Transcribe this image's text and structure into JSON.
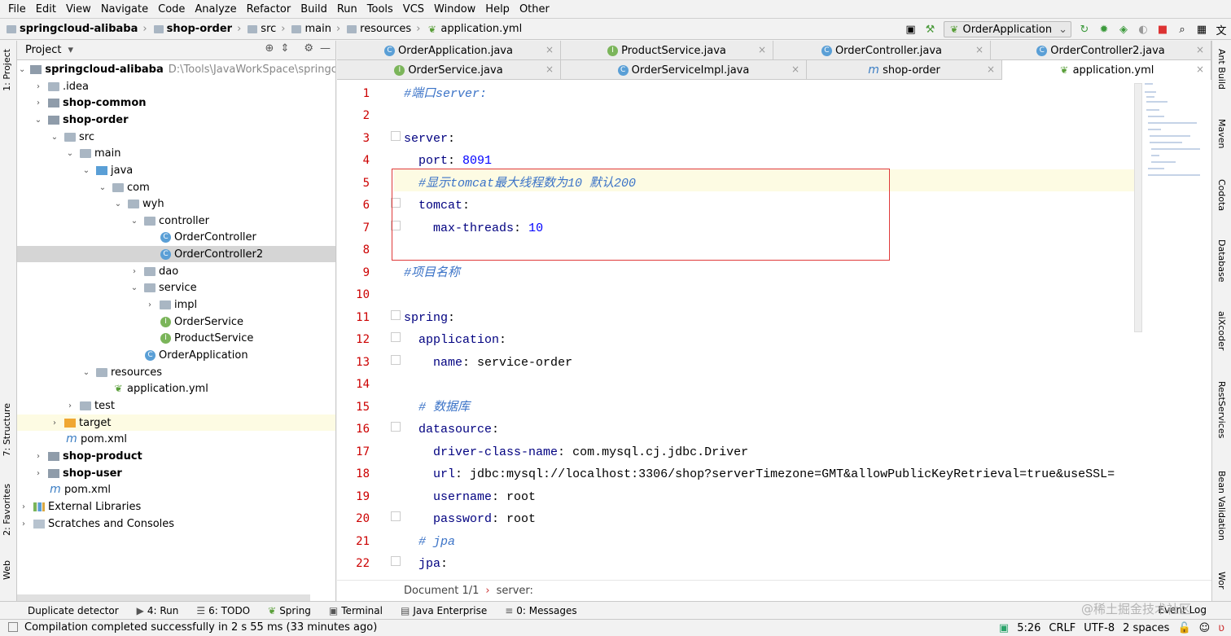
{
  "menu": [
    "File",
    "Edit",
    "View",
    "Navigate",
    "Code",
    "Analyze",
    "Refactor",
    "Build",
    "Run",
    "Tools",
    "VCS",
    "Window",
    "Help",
    "Other"
  ],
  "breadcrumbs": [
    "springcloud-alibaba",
    "shop-order",
    "src",
    "main",
    "resources",
    "application.yml"
  ],
  "run_config": "OrderApplication",
  "left_tabs": {
    "project": "1: Project",
    "structure": "7: Structure",
    "favorites": "2: Favorites",
    "web": "Web"
  },
  "right_tabs": [
    "Ant Build",
    "Maven",
    "Codota",
    "Database",
    "aiXcoder",
    "RestServices",
    "Bean Validation",
    "Wor"
  ],
  "project_panel": {
    "title": "Project"
  },
  "tree": [
    {
      "label": "springcloud-alibaba",
      "hint": "D:\\Tools\\JavaWorkSpace\\springcloud-a"
    },
    {
      "label": ".idea"
    },
    {
      "label": "shop-common"
    },
    {
      "label": "shop-order"
    },
    {
      "label": "src"
    },
    {
      "label": "main"
    },
    {
      "label": "java"
    },
    {
      "label": "com"
    },
    {
      "label": "wyh"
    },
    {
      "label": "controller"
    },
    {
      "label": "OrderController"
    },
    {
      "label": "OrderController2"
    },
    {
      "label": "dao"
    },
    {
      "label": "service"
    },
    {
      "label": "impl"
    },
    {
      "label": "OrderService"
    },
    {
      "label": "ProductService"
    },
    {
      "label": "OrderApplication"
    },
    {
      "label": "resources"
    },
    {
      "label": "application.yml"
    },
    {
      "label": "test"
    },
    {
      "label": "target"
    },
    {
      "label": "pom.xml"
    },
    {
      "label": "shop-product"
    },
    {
      "label": "shop-user"
    },
    {
      "label": "pom.xml"
    },
    {
      "label": "External Libraries"
    },
    {
      "label": "Scratches and Consoles"
    }
  ],
  "tabs_row1": [
    "OrderApplication.java",
    "ProductService.java",
    "OrderController.java",
    "OrderController2.java"
  ],
  "tabs_row2": [
    "OrderService.java",
    "OrderServiceImpl.java",
    "shop-order",
    "application.yml"
  ],
  "line_numbers": [
    "1",
    "2",
    "3",
    "4",
    "5",
    "6",
    "7",
    "8",
    "9",
    "10",
    "11",
    "12",
    "13",
    "14",
    "15",
    "16",
    "17",
    "18",
    "19",
    "20",
    "21",
    "22"
  ],
  "code": {
    "l1": "#端口server:",
    "l3k": "server",
    "l4k": "port",
    "l4v": "8091",
    "l5": "#显示tomcat最大线程数为10 默认200",
    "l6k": "tomcat",
    "l7k": "max-threads",
    "l7v": "10",
    "l9": "#项目名称",
    "l11k": "spring",
    "l12k": "application",
    "l13k": "name",
    "l13v": "service-order",
    "l15": "# 数据库",
    "l16k": "datasource",
    "l17k": "driver-class-name",
    "l17v": "com.mysql.cj.jdbc.Driver",
    "l18k": "url",
    "l18v": "jdbc:mysql://localhost:3306/shop?serverTimezone=GMT&allowPublicKeyRetrieval=true&useSSL=",
    "l19k": "username",
    "l19v": "root",
    "l20k": "password",
    "l20v": "root",
    "l21": "# jpa",
    "l22k": "jpa"
  },
  "editor_breadcrumb": {
    "doc": "Document 1/1",
    "path": "server:"
  },
  "bottom_tools": [
    "Duplicate detector",
    "4: Run",
    "6: TODO",
    "Spring",
    "Terminal",
    "Java Enterprise",
    "0: Messages"
  ],
  "event_log": "Event Log",
  "status": {
    "message": "Compilation completed successfully in 2 s 55 ms (33 minutes ago)",
    "position": "5:26",
    "line_sep": "CRLF",
    "encoding": "UTF-8",
    "indent": "2 spaces"
  },
  "watermark": "@稀土掘金技术社区"
}
